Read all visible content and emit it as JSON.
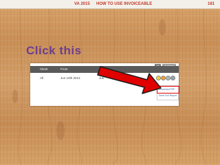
{
  "header": {
    "code": "VA 2015",
    "title": "HOW TO USE INVOICEABLE",
    "page": "181"
  },
  "headline": "Click this",
  "table": {
    "top_buttons": [
      "All",
      "Archived"
    ],
    "columns": [
      "Client",
      "From",
      "To"
    ],
    "rows": [
      {
        "client": "All",
        "from": "Jun 10th 2013",
        "to": "Jun"
      }
    ]
  },
  "row_icons": [
    "view-icon",
    "edit-icon",
    "email-icon",
    "delete-icon"
  ],
  "dropdown": {
    "items": [
      "Download PDF",
      "Send Full Report"
    ]
  },
  "colors": {
    "header_text": "#c0392b",
    "headline": "#6a3d8f",
    "table_header": "#5a5a5a",
    "highlight": "#e00000",
    "arrow": "#e00000"
  }
}
